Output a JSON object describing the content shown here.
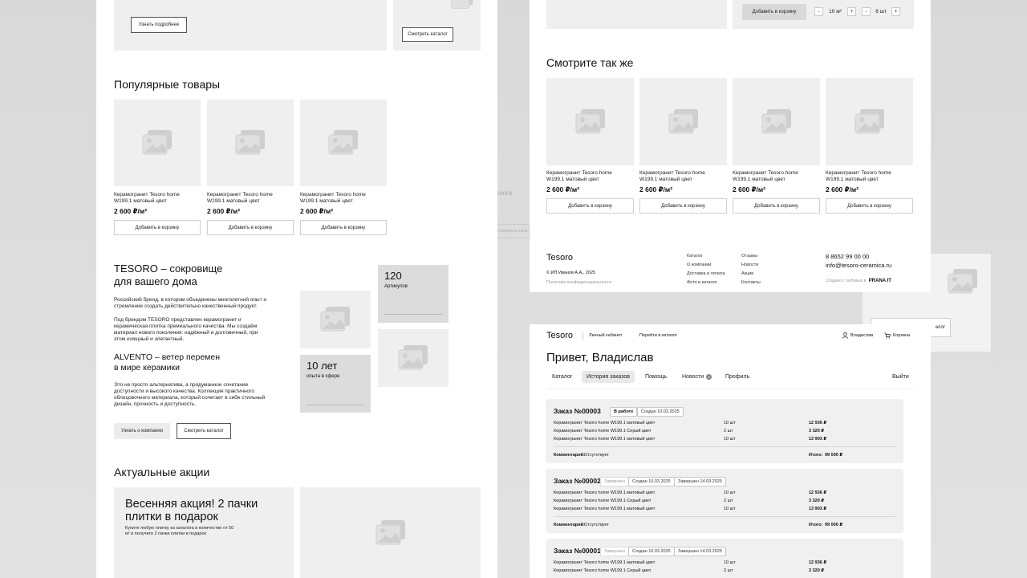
{
  "left": {
    "top_btn_more": "Узнать подробнее",
    "top_btn_catalog": "Смотреть каталог",
    "popular_title": "Популярные товары",
    "products": [
      {
        "name": "Керамогранит Tesoro home W199.1 матовый цвет",
        "price": "2 600 ₽/м²",
        "button": "Добавить в корзину"
      },
      {
        "name": "Керамогранит Tesoro home W199.1 матовый цвет",
        "price": "2 600 ₽/м²",
        "button": "Добавить в корзину"
      },
      {
        "name": "Керамогранит Tesoro home W199.1 матовый цвет",
        "price": "2 600 ₽/м²",
        "button": "Добавить в корзину"
      }
    ],
    "about_title": "TESORO – сокровище для вашего дома",
    "about_p1": "Российский бренд, в котором объединены многолетний опыт и стремление создать действительно качественный продукт.",
    "about_p2": "Под брендом TESORO представлен керамогранит и керамическая плитка премиального качества. Мы создаём материал нового поколения: надёжный и долговечный, при этом изящный и элегантный.",
    "alvento_title": "ALVENTO – ветер перемен в мире керамики",
    "alvento_p": "Это не просто альтернатива, а продуманное сочетание доступности и высокого качества. Коллекция практичного облицовочного материала, который сочетает в себе стильный дизайн, прочность и доступность.",
    "stat1_value": "120",
    "stat1_label": "Артикулов",
    "stat2_value": "10 лет",
    "stat2_label": "опыта в сфере",
    "btn_about": "Узнать о компании",
    "btn_catalog": "Смотреть каталог",
    "promo_title": "Актуальные акции",
    "promo_headline": "Весенняя акция! 2 пачки плитки в подарок",
    "promo_text": "Купите любую плитку из каталога в количестве от 50 м² и получите 2 пачки плитки в подарок"
  },
  "right_top": {
    "add_to_cart": "Добавить в корзину",
    "qty_m2": "10 м²",
    "qty_pcs": "6 шт",
    "minus": "-",
    "plus": "+",
    "see_also_title": "Смотрите так же",
    "products": [
      {
        "name": "Керамогранит Tesoro home W199.1 матовый цвет",
        "price": "2 600 ₽/м²",
        "button": "Добавить в корзину"
      },
      {
        "name": "Керамогранит Tesoro home W199.1 матовый цвет",
        "price": "2 600 ₽/м²",
        "button": "Добавить в корзину"
      },
      {
        "name": "Керамогранит Tesoro home W199.1 матовый цвет",
        "price": "2 600 ₽/м²",
        "button": "Добавить в корзину"
      },
      {
        "name": "Керамогранит Tesoro home W199.1 матовый цвет",
        "price": "2 600 ₽/м²",
        "button": "Добавить в корзину"
      }
    ],
    "footer": {
      "logo": "Tesoro",
      "copyright": "© ИП Иванов А.А., 2025",
      "privacy": "Политика конфиденциальности",
      "col1": [
        "Каталог",
        "О компании",
        "Доставка и оплата",
        "Фото в каталог"
      ],
      "col2": [
        "Отзывы",
        "Новости",
        "Акции",
        "Контакты"
      ],
      "phone": "8 8652 99 00 00",
      "email": "info@tesoro-ceramica.ru",
      "made_by": "Создано с любовью в",
      "made_by_brand": "PRANA IT"
    }
  },
  "behind": {
    "logo_fragment": "esora",
    "btn_fragment": "Смотреть ката",
    "btn_fragment2": "алог"
  },
  "cabinet": {
    "logo": "Tesoro",
    "nav_cabinet": "Личный кабинет",
    "nav_catalog": "Перейти в каталог",
    "user": "Владислав",
    "cart": "Корзина",
    "greeting": "Привет, Владислав",
    "tabs": [
      "Каталог",
      "История заказов",
      "Помощь",
      "Новости",
      "Профиль"
    ],
    "news_count": "1",
    "logout": "Выйти",
    "comment_label": "Комментарий:",
    "comment_value": "Отсутствует",
    "total_label": "Итого:",
    "total_value": "99 000 ₽",
    "orders": [
      {
        "title": "Заказ №00003",
        "status": "В работе",
        "created": "Создан 10.03.2025",
        "finished": "",
        "items": [
          {
            "name": "Керамогранит Tesoro home W199.1 матовый цвет",
            "qty": "10 шт",
            "sum": "12 936 ₽"
          },
          {
            "name": "Керамогранит Tesoro home W199.1 Серый цвет",
            "qty": "2 шт",
            "sum": "3 320 ₽"
          },
          {
            "name": "Керамогранит Tesoro home W199.1 матовый цвет",
            "qty": "10 шт",
            "sum": "13 903 ₽"
          }
        ]
      },
      {
        "title": "Заказ №00002",
        "status": "Завершен",
        "created": "Создан 10.03.2025",
        "finished": "Завершен 14.03.2025",
        "items": [
          {
            "name": "Керамогранит Tesoro home W199.1 матовый цвет",
            "qty": "10 шт",
            "sum": "12 936 ₽"
          },
          {
            "name": "Керамогранит Tesoro home W199.1 Серый цвет",
            "qty": "2 шт",
            "sum": "3 320 ₽"
          },
          {
            "name": "Керамогранит Tesoro home W199.1 матовый цвет",
            "qty": "10 шт",
            "sum": "13 903 ₽"
          }
        ]
      },
      {
        "title": "Заказ №00001",
        "status": "Завершен",
        "created": "Создан 10.03.2025",
        "finished": "Завершен 14.03.2025",
        "items": [
          {
            "name": "Керамогранит Tesoro home W199.1 матовый цвет",
            "qty": "10 шт",
            "sum": "12 936 ₽"
          },
          {
            "name": "Керамогранит Tesoro home W199.1 Серый цвет",
            "qty": "2 шт",
            "sum": "3 320 ₽"
          }
        ]
      }
    ]
  }
}
